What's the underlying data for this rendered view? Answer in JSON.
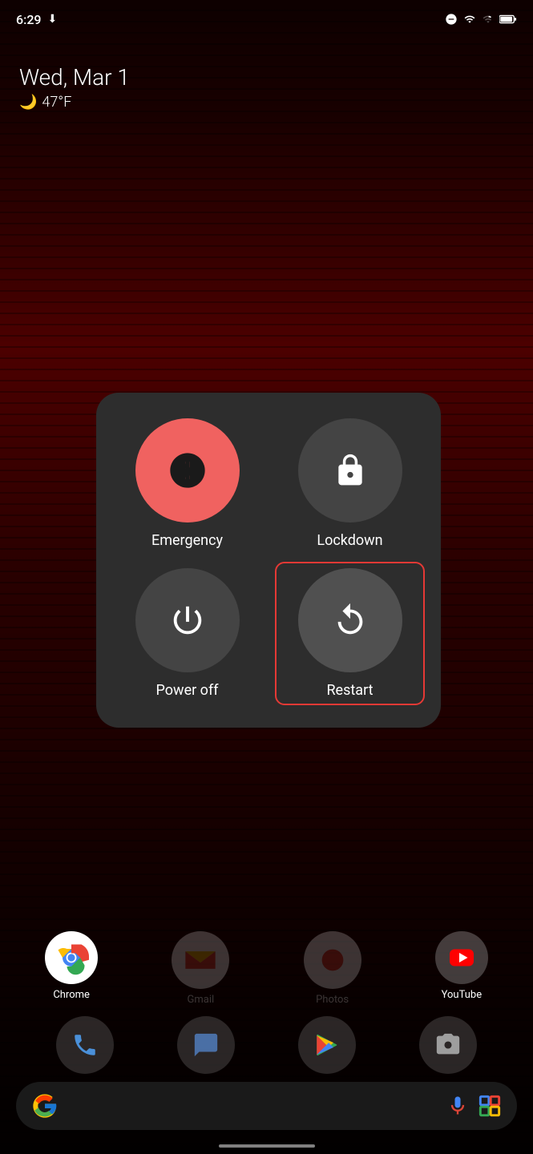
{
  "statusBar": {
    "time": "6:29",
    "downloadIcon": "⬇",
    "doNotDisturb": "⊖",
    "wifi": "wifi",
    "signal": "signal",
    "battery": "battery"
  },
  "dateWeather": {
    "date": "Wed, Mar 1",
    "weatherIcon": "🌙",
    "temperature": "47°F"
  },
  "powerMenu": {
    "emergency": {
      "label": "Emergency",
      "iconSymbol": "✳"
    },
    "lockdown": {
      "label": "Lockdown",
      "iconSymbol": "🔒"
    },
    "powerOff": {
      "label": "Power off",
      "iconSymbol": "⏻"
    },
    "restart": {
      "label": "Restart",
      "iconSymbol": "↺"
    }
  },
  "bottomApps": {
    "chrome": "Chrome",
    "gmail": "Gmail",
    "photos": "Photos",
    "youtube": "YouTube"
  },
  "dock": {
    "phone": "📞",
    "messages": "💬",
    "playstore": "▶",
    "camera": "📷"
  },
  "searchBar": {
    "micIcon": "🎤",
    "lensIcon": "🔲"
  },
  "colors": {
    "emergencyCircle": "#f06260",
    "defaultCircle": "#444444",
    "restartCircle": "#505050",
    "menuBackground": "#2d2d2d",
    "restartBorder": "#e53935"
  }
}
